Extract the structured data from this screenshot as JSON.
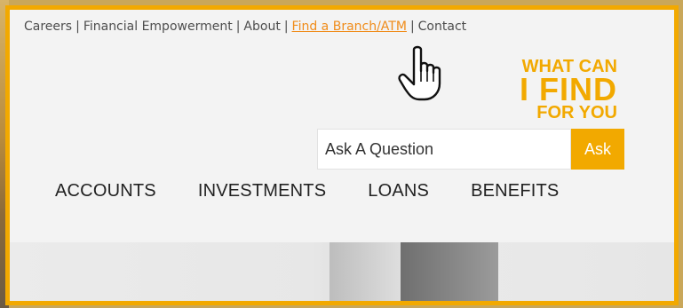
{
  "topbar": {
    "links": [
      {
        "label": "Careers"
      },
      {
        "label": "Financial Empowerment"
      },
      {
        "label": "About"
      },
      {
        "label": "Find a Branch/ATM",
        "active": true
      },
      {
        "label": "Contact"
      }
    ],
    "separator": "|"
  },
  "tagline": {
    "line1": "WHAT CAN",
    "line2": "I FIND",
    "line3": "FOR YOU"
  },
  "search": {
    "placeholder": "Ask A Question",
    "button_label": "Ask"
  },
  "nav": {
    "items": [
      {
        "label": "ACCOUNTS"
      },
      {
        "label": "INVESTMENTS"
      },
      {
        "label": "LOANS"
      },
      {
        "label": "BENEFITS"
      }
    ]
  },
  "colors": {
    "accent": "#f2a900",
    "link_active": "#f08c1a",
    "frame_bg": "#f3f3f3"
  },
  "icons": {
    "cursor": "hand-pointer-icon"
  }
}
